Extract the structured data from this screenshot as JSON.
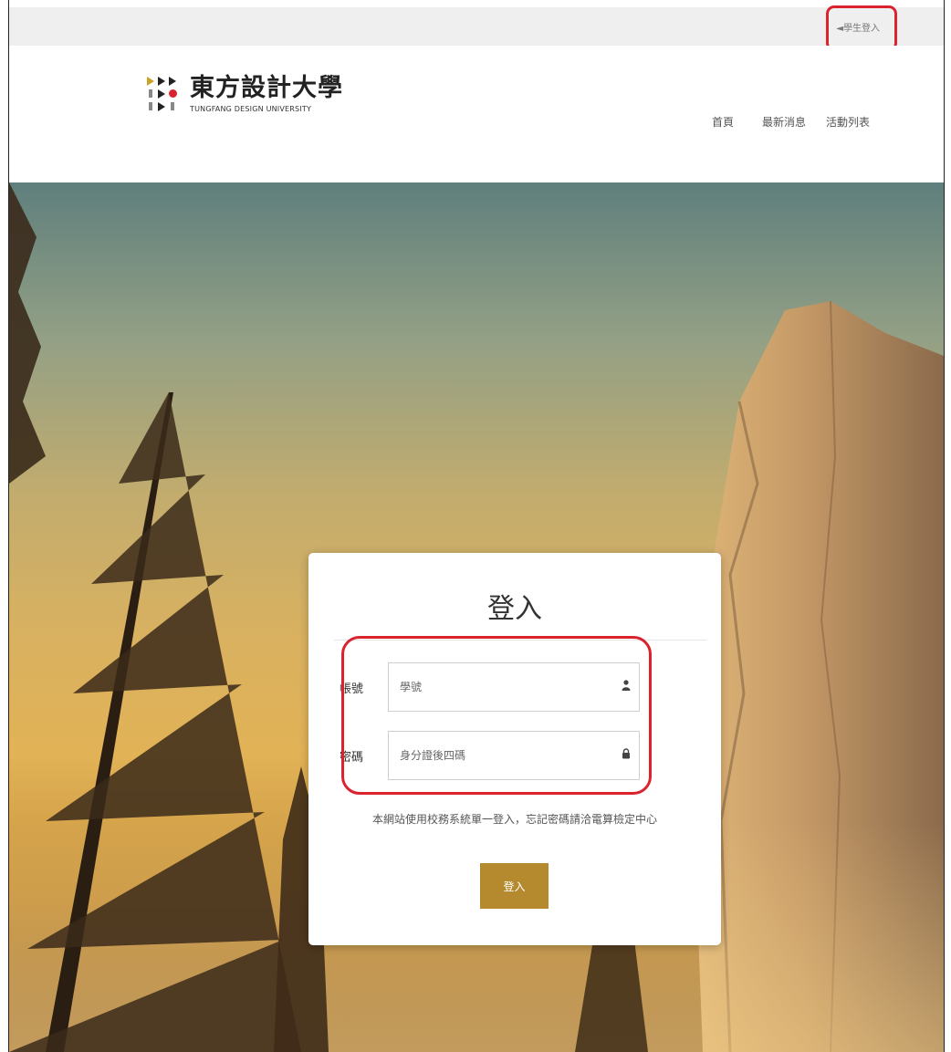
{
  "topbar": {
    "login_link": "◄學生登入"
  },
  "header": {
    "logo_cn": "東方設計大學",
    "logo_en": "TUNGFANG DESIGN UNIVERSITY",
    "nav": [
      "首頁",
      "最新消息",
      "活動列表"
    ]
  },
  "login": {
    "title": "登入",
    "account_label": "帳號",
    "account_placeholder": "學號",
    "password_label": "密碼",
    "password_placeholder": "身分證後四碼",
    "note": "本網站使用校務系統單一登入，忘記密碼請洽電算檢定中心",
    "submit_label": "登入"
  },
  "colors": {
    "accent": "#b58a2f",
    "highlight": "#d9242f"
  },
  "icons": {
    "account": "user-icon",
    "password": "lock-icon"
  }
}
